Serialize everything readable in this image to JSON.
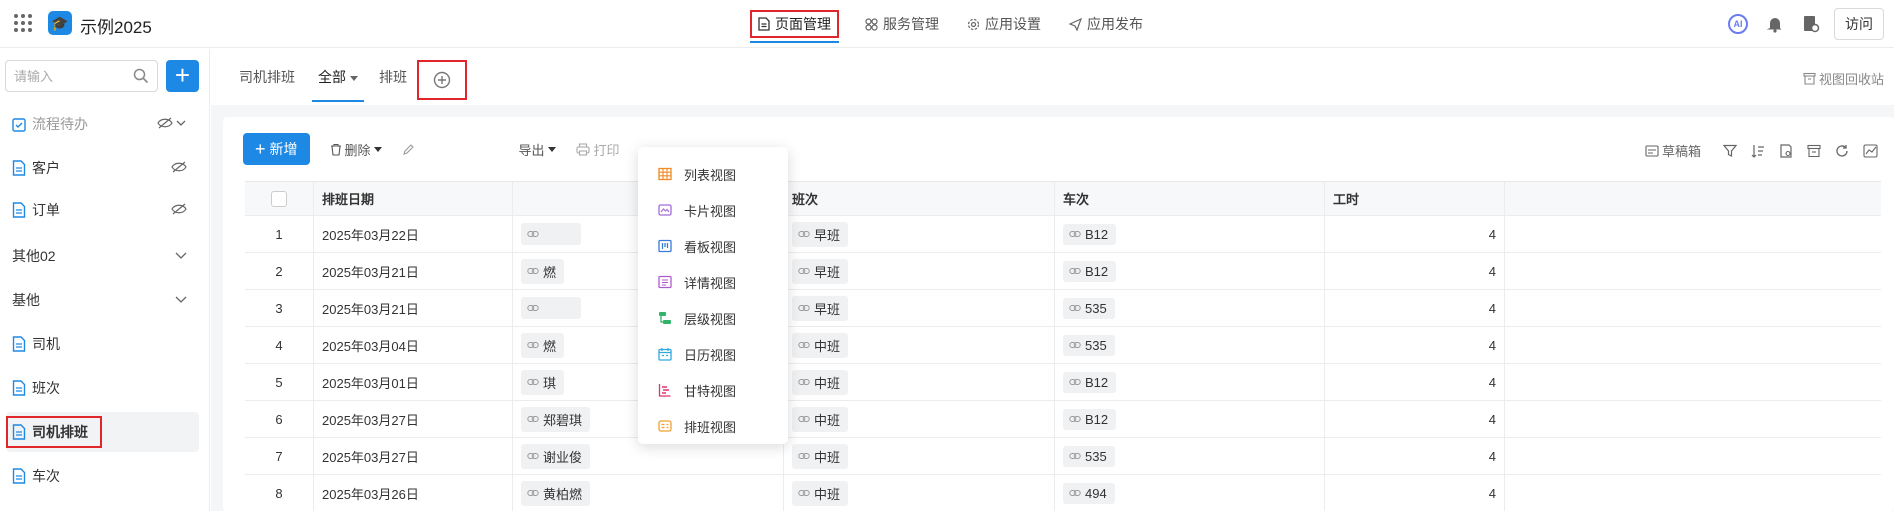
{
  "app": {
    "title": "示例2025"
  },
  "top_nav": [
    {
      "label": "页面管理",
      "active": true
    },
    {
      "label": "服务管理",
      "active": false
    },
    {
      "label": "应用设置",
      "active": false
    },
    {
      "label": "应用发布",
      "active": false
    }
  ],
  "top_right": {
    "ai_label": "AI",
    "visit_label": "访问"
  },
  "sidebar": {
    "search_placeholder": "请输入",
    "items": [
      {
        "label": "流程待办"
      },
      {
        "label": "客户"
      },
      {
        "label": "订单"
      },
      {
        "label": "其他02"
      },
      {
        "label": "基他"
      },
      {
        "label": "司机"
      },
      {
        "label": "班次"
      },
      {
        "label": "司机排班"
      },
      {
        "label": "车次"
      }
    ]
  },
  "tabs": {
    "t1": "司机排班",
    "t2": "全部",
    "t3": "排班",
    "recycle": "视图回收站"
  },
  "toolbar": {
    "new": "新增",
    "delete": "删除",
    "export_partial": "导出",
    "print": "打印",
    "draft": "草稿箱"
  },
  "table": {
    "headers": {
      "date": "排班日期",
      "shift": "班次",
      "train": "车次",
      "hours": "工时"
    },
    "rows": [
      {
        "idx": "1",
        "date": "2025年03月22日",
        "driver": "",
        "shift": "早班",
        "train": "B12",
        "hours": "4"
      },
      {
        "idx": "2",
        "date": "2025年03月21日",
        "driver": "燃",
        "shift": "早班",
        "train": "B12",
        "hours": "4"
      },
      {
        "idx": "3",
        "date": "2025年03月21日",
        "driver": "",
        "shift": "早班",
        "train": "535",
        "hours": "4"
      },
      {
        "idx": "4",
        "date": "2025年03月04日",
        "driver": "燃",
        "shift": "中班",
        "train": "535",
        "hours": "4"
      },
      {
        "idx": "5",
        "date": "2025年03月01日",
        "driver": "琪",
        "shift": "中班",
        "train": "B12",
        "hours": "4"
      },
      {
        "idx": "6",
        "date": "2025年03月27日",
        "driver": "郑碧琪",
        "shift": "中班",
        "train": "B12",
        "hours": "4"
      },
      {
        "idx": "7",
        "date": "2025年03月27日",
        "driver": "谢业俊",
        "shift": "中班",
        "train": "535",
        "hours": "4"
      },
      {
        "idx": "8",
        "date": "2025年03月26日",
        "driver": "黄柏燃",
        "shift": "中班",
        "train": "494",
        "hours": "4"
      }
    ]
  },
  "view_menu": [
    {
      "label": "列表视图",
      "color": "#f08a24"
    },
    {
      "label": "卡片视图",
      "color": "#a46ad8"
    },
    {
      "label": "看板视图",
      "color": "#3a7bd5"
    },
    {
      "label": "详情视图",
      "color": "#b05ad0"
    },
    {
      "label": "层级视图",
      "color": "#32b36b"
    },
    {
      "label": "日历视图",
      "color": "#30a9e0"
    },
    {
      "label": "甘特视图",
      "color": "#e0336b"
    },
    {
      "label": "排班视图",
      "color": "#f0a030"
    }
  ],
  "colors": {
    "accent": "#1e88e5",
    "highlight": "#e0262b"
  }
}
